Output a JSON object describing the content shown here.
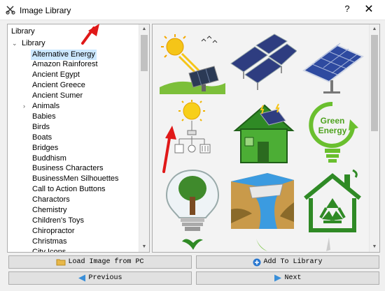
{
  "window": {
    "title": "Image Library",
    "help_glyph": "?",
    "close_glyph": "✕"
  },
  "tree": {
    "header": "Library",
    "root": "Library",
    "items": [
      {
        "label": "Alternative Energy",
        "selected": true
      },
      {
        "label": "Amazon Rainforest"
      },
      {
        "label": "Ancient Egypt"
      },
      {
        "label": "Ancient Greece"
      },
      {
        "label": "Ancient Sumer"
      },
      {
        "label": "Animals",
        "expandable": true
      },
      {
        "label": "Babies"
      },
      {
        "label": "Birds"
      },
      {
        "label": "Boats"
      },
      {
        "label": "Bridges"
      },
      {
        "label": "Buddhism"
      },
      {
        "label": "Business Characters"
      },
      {
        "label": "BusinessMen Silhouettes"
      },
      {
        "label": "Call to Action Buttons"
      },
      {
        "label": "Charactors"
      },
      {
        "label": "Chemistry"
      },
      {
        "label": "Children's Toys"
      },
      {
        "label": "Chiropractor"
      },
      {
        "label": "Christmas"
      },
      {
        "label": "City Icons"
      }
    ]
  },
  "grid": {
    "images": [
      {
        "name": "solar-sun-panel-image"
      },
      {
        "name": "solar-array-image"
      },
      {
        "name": "solar-panel-stand-image"
      },
      {
        "name": "sun-power-diagram-image"
      },
      {
        "name": "green-solar-house-image"
      },
      {
        "name": "green-energy-bulb-image",
        "text_line1": "Green",
        "text_line2": "Energy"
      },
      {
        "name": "tree-in-bulb-image"
      },
      {
        "name": "hydro-dam-image"
      },
      {
        "name": "recycle-house-image"
      }
    ]
  },
  "buttons": {
    "load": "Load Image from PC",
    "add": "Add To Library",
    "previous": "Previous",
    "next": "Next"
  },
  "colors": {
    "selection": "#cce8ff",
    "annotation": "#e01818",
    "green": "#3a9a2a"
  }
}
